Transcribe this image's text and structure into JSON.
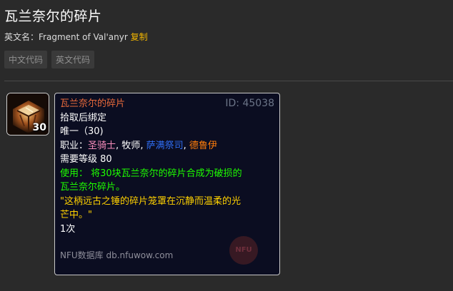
{
  "page": {
    "title": "瓦兰奈尔的碎片",
    "en_label": "英文名：",
    "en_name": "Fragment of Val'anyr",
    "copy_label": "复制"
  },
  "code_tabs": [
    {
      "label": "中文代码"
    },
    {
      "label": "英文代码"
    }
  ],
  "icon": {
    "name": "val-anyr-fragment-icon",
    "stack_count": "30"
  },
  "tooltip": {
    "name": "瓦兰奈尔的碎片",
    "id_text": "ID: 45038",
    "bind": "拾取后绑定",
    "unique": "唯一（30)",
    "class_label": "职业：",
    "classes": [
      {
        "name": "圣骑士",
        "color": "#f58cba"
      },
      {
        "name": "牧师",
        "color": "#ffffff"
      },
      {
        "name": "萨满祭司",
        "color": "#2f6cf0"
      },
      {
        "name": "德鲁伊",
        "color": "#ff7d0a"
      }
    ],
    "separator": ", ",
    "level": "需要等级 80",
    "use_line1": "使用：  将30块瓦兰奈尔的碎片合成为破损的",
    "use_line2": "瓦兰奈尔碎片。",
    "flavor_line1": "\"这柄远古之锤的碎片笼罩在沉静而温柔的光",
    "flavor_line2": "芒中。\"",
    "count": "1次",
    "footer": "NFU数据库 db.nfuwow.com",
    "logo_text": "NFU"
  },
  "colors": {
    "item_name": "#e96a3b",
    "use": "#1eff00",
    "flavor": "#ffd100",
    "copy": "#f0b400"
  }
}
